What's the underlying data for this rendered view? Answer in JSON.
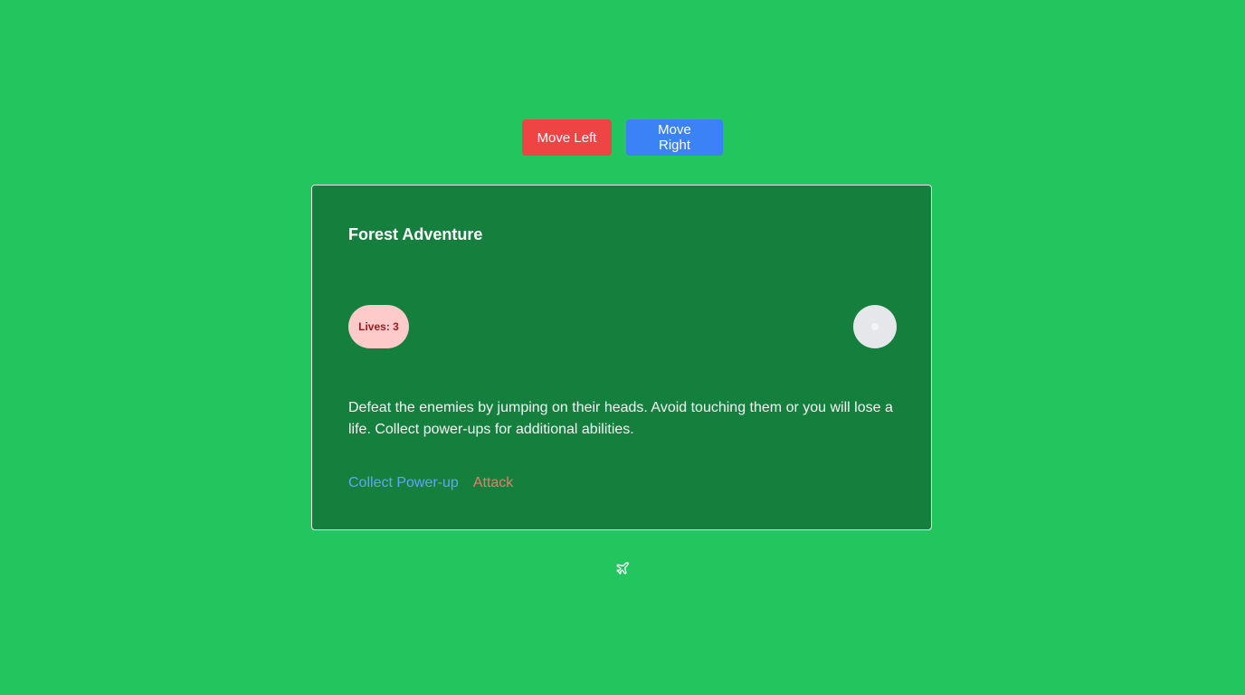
{
  "controls": {
    "move_left_label": "Move Left",
    "move_right_label": "Move Right"
  },
  "card": {
    "title": "Forest Adventure",
    "lives_label": "Lives: 3",
    "description": "Defeat the enemies by jumping on their heads. Avoid touching them or you will lose a life. Collect power-ups for additional abilities.",
    "actions": {
      "powerup_label": "Collect Power-up",
      "attack_label": "Attack"
    }
  },
  "icons": {
    "enemy": "enemy-icon",
    "footer": "plane-icon"
  },
  "colors": {
    "background": "#22c55e",
    "card": "#15803d",
    "move_left": "#ef4444",
    "move_right": "#3b82f6",
    "powerup_link": "#60a5fa",
    "attack_link": "#f87171",
    "lives_badge_bg": "#fecaca",
    "lives_badge_text": "#991b1b"
  }
}
